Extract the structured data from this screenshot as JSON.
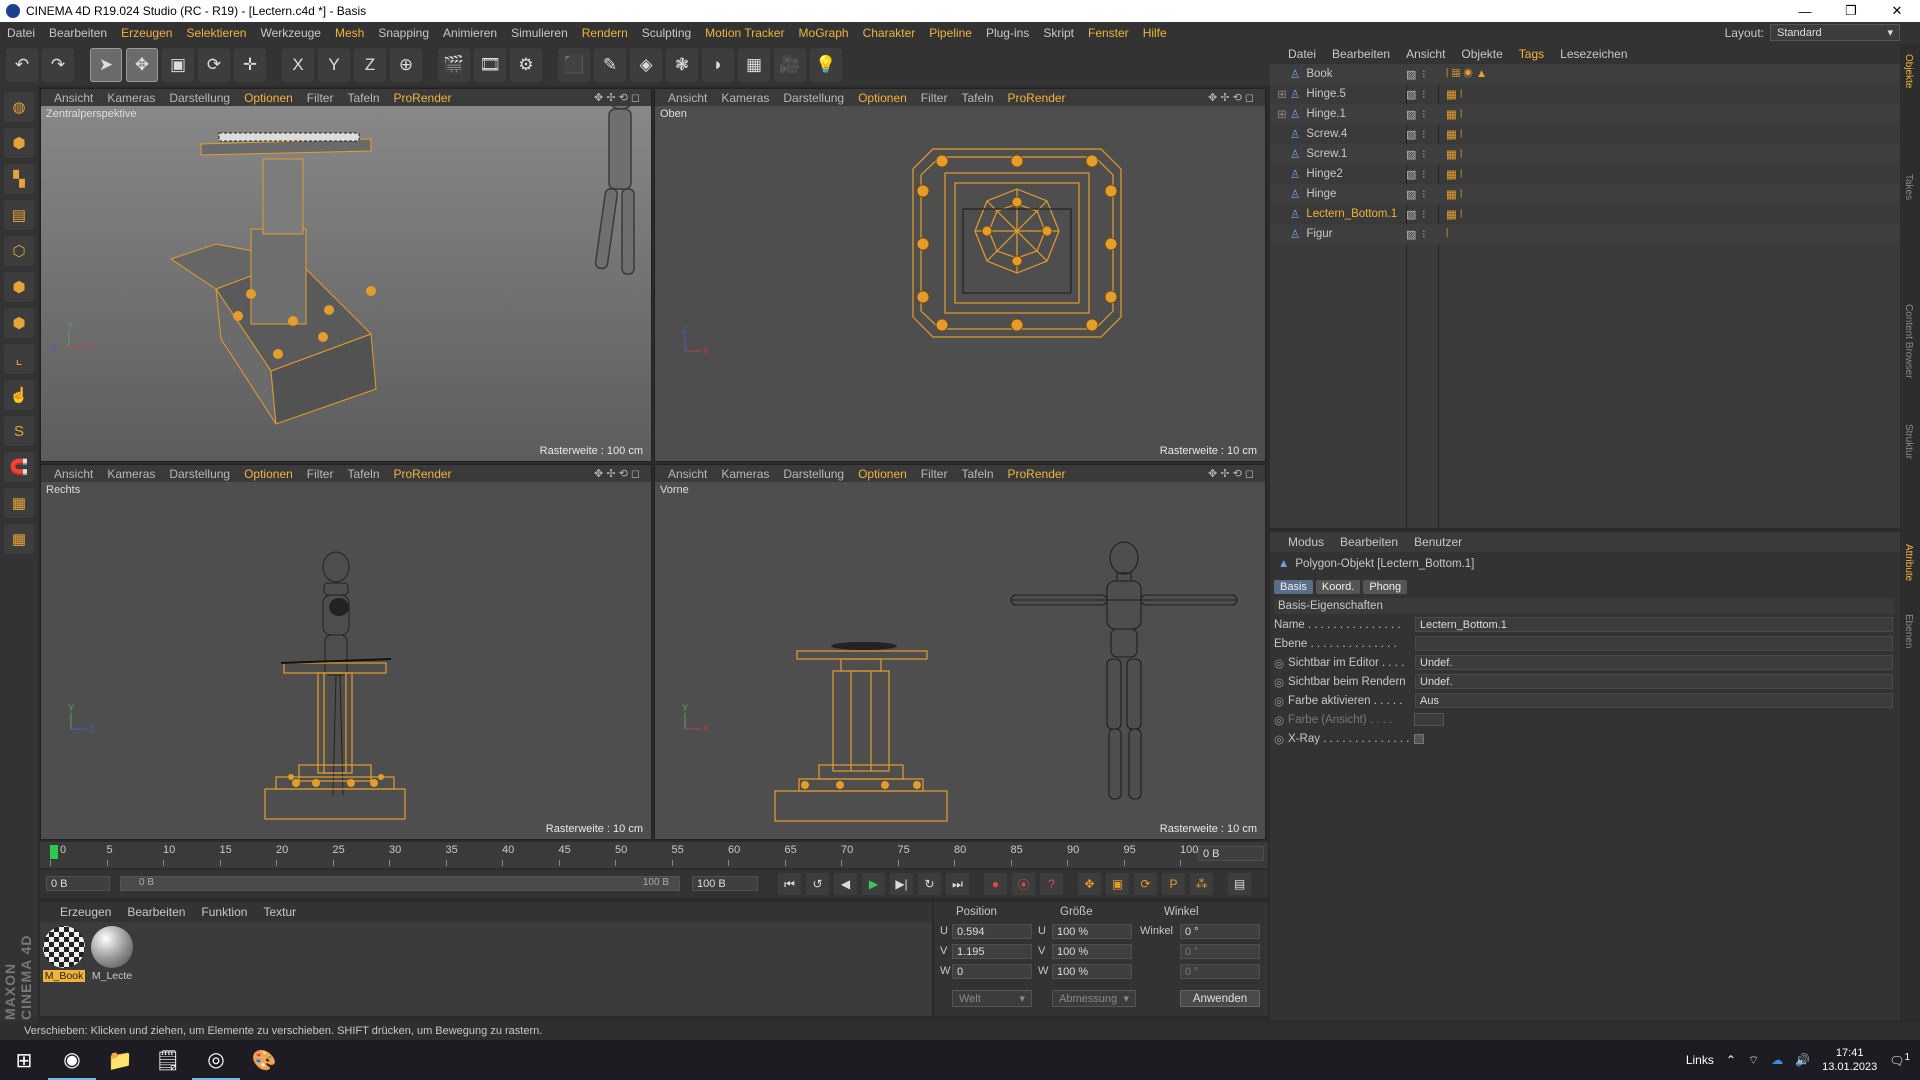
{
  "window": {
    "title": "CINEMA 4D R19.024 Studio (RC - R19) - [Lectern.c4d *] - Basis",
    "minimize": "—",
    "maximize": "❐",
    "close": "✕"
  },
  "menubar": {
    "items": [
      {
        "label": "Datei",
        "hi": false
      },
      {
        "label": "Bearbeiten",
        "hi": false
      },
      {
        "label": "Erzeugen",
        "hi": true
      },
      {
        "label": "Selektieren",
        "hi": true
      },
      {
        "label": "Werkzeuge",
        "hi": false
      },
      {
        "label": "Mesh",
        "hi": true
      },
      {
        "label": "Snapping",
        "hi": false
      },
      {
        "label": "Animieren",
        "hi": false
      },
      {
        "label": "Simulieren",
        "hi": false
      },
      {
        "label": "Rendern",
        "hi": true
      },
      {
        "label": "Sculpting",
        "hi": false
      },
      {
        "label": "Motion Tracker",
        "hi": true
      },
      {
        "label": "MoGraph",
        "hi": true
      },
      {
        "label": "Charakter",
        "hi": true
      },
      {
        "label": "Pipeline",
        "hi": true
      },
      {
        "label": "Plug-ins",
        "hi": false
      },
      {
        "label": "Skript",
        "hi": false
      },
      {
        "label": "Fenster",
        "hi": true
      },
      {
        "label": "Hilfe",
        "hi": true
      }
    ],
    "layout_label": "Layout:",
    "layout_value": "Standard"
  },
  "toolbar": {
    "icons": [
      "undo-icon",
      "redo-icon",
      "select-arrow-icon",
      "move-icon",
      "scale-icon",
      "rotate-icon",
      "last-tool-icon",
      "x-axis-icon",
      "y-axis-icon",
      "z-axis-icon",
      "world-coord-icon",
      "render-view-icon",
      "render-picture-viewer-icon",
      "render-settings-icon",
      "cube-icon",
      "pen-icon",
      "subdivision-icon",
      "cloner-icon",
      "deformer-icon",
      "floor-icon",
      "camera-icon",
      "light-icon"
    ],
    "glyphs": [
      "↶",
      "↷",
      "➤",
      "✥",
      "▣",
      "⟳",
      "✛",
      "X",
      "Y",
      "Z",
      "⊕",
      "🎬",
      "🎞",
      "⚙",
      "⬛",
      "✎",
      "◈",
      "❃",
      "◗",
      "▦",
      "🎥",
      "💡"
    ]
  },
  "lefttools": {
    "icons": [
      "make-editable-icon",
      "model-mode-icon",
      "texture-mode-icon",
      "workplane-icon",
      "points-mode-icon",
      "edges-mode-icon",
      "polygons-mode-icon",
      "axis-mode-icon",
      "tweak-mode-icon",
      "solo-icon",
      "magnet-icon",
      "snap-grid-icon",
      "snap-settings-icon"
    ],
    "glyphs": [
      "◍",
      "⬢",
      "▚",
      "▤",
      "⬡",
      "⬢",
      "⬢",
      "⌞",
      "☝",
      "S",
      "🧲",
      "▦",
      "▦"
    ]
  },
  "viewport_menu": {
    "ansicht": "Ansicht",
    "kameras": "Kameras",
    "darstellung": "Darstellung",
    "optionen": "Optionen",
    "filter": "Filter",
    "tafeln": "Tafeln",
    "prorender": "ProRender"
  },
  "viewport_icons": "✥ ✢ ⟲ ◻",
  "viewports": [
    {
      "name": "Zentralperspektive",
      "grid": "Rasterweite : 100 cm"
    },
    {
      "name": "Oben",
      "grid": "Rasterweite : 10 cm"
    },
    {
      "name": "Rechts",
      "grid": "Rasterweite : 10 cm"
    },
    {
      "name": "Vorne",
      "grid": "Rasterweite : 10 cm"
    }
  ],
  "object_manager": {
    "menu": [
      "Datei",
      "Bearbeiten",
      "Ansicht",
      "Objekte",
      "Tags",
      "Lesezeichen"
    ],
    "objects": [
      {
        "name": "Book",
        "hi": false
      },
      {
        "name": "Hinge.5",
        "hi": false
      },
      {
        "name": "Hinge.1",
        "hi": false
      },
      {
        "name": "Screw.4",
        "hi": false
      },
      {
        "name": "Screw.1",
        "hi": false
      },
      {
        "name": "Hinge2",
        "hi": false
      },
      {
        "name": "Hinge",
        "hi": false
      },
      {
        "name": "Lectern_Bottom.1",
        "hi": true
      },
      {
        "name": "Figur",
        "hi": false
      }
    ]
  },
  "attributes": {
    "menu": [
      "Modus",
      "Bearbeiten",
      "Benutzer"
    ],
    "object_title": "Polygon-Objekt [Lectern_Bottom.1]",
    "tabs": [
      "Basis",
      "Koord.",
      "Phong"
    ],
    "section": "Basis-Eigenschaften",
    "rows": [
      {
        "label": "Name . . . . . . . . . . . . . . .",
        "value": "Lectern_Bottom.1"
      },
      {
        "label": "Ebene . . . . . . . . . . . . . .",
        "value": ""
      },
      {
        "label": "Sichtbar im Editor . . . .",
        "value": "Undef."
      },
      {
        "label": "Sichtbar beim Rendern",
        "value": "Undef."
      },
      {
        "label": "Farbe aktivieren . . . . .",
        "value": "Aus"
      },
      {
        "label": "Farbe (Ansicht) . . . .",
        "value": ""
      },
      {
        "label": "X-Ray . . . . . . . . . . . . . .",
        "value": ""
      }
    ]
  },
  "right_tabs": [
    "Objekte",
    "Takes",
    "Content Browser",
    "Struktur",
    "Attribute",
    "Ebenen"
  ],
  "timeline": {
    "ticks": [
      "0",
      "5",
      "10",
      "15",
      "20",
      "25",
      "30",
      "35",
      "40",
      "45",
      "50",
      "55",
      "60",
      "65",
      "70",
      "75",
      "80",
      "85",
      "90",
      "95",
      "100"
    ],
    "frame_display": "0 B",
    "start": "0 B",
    "range_start": "0 B",
    "range_end": "100 B",
    "end": "100 B"
  },
  "playback": {
    "icons": [
      "go-start-icon",
      "prev-key-icon",
      "prev-frame-icon",
      "play-icon",
      "next-frame-icon",
      "next-key-icon",
      "go-end-icon",
      "record-icon",
      "autokey-icon",
      "keyframe-selection-icon",
      "move-key-icon",
      "scale-key-icon",
      "rotate-key-icon",
      "param-key-icon",
      "pla-key-icon",
      "timeline-icon"
    ],
    "glyphs": [
      "⏮",
      "↺",
      "◀",
      "▶",
      "▶|",
      "↻",
      "⏭",
      "●",
      "⦿",
      "?",
      "✥",
      "▣",
      "⟳",
      "P",
      "⁂",
      "▤"
    ]
  },
  "materials": {
    "menu": [
      "Erzeugen",
      "Bearbeiten",
      "Funktion",
      "Textur"
    ],
    "items": [
      "M_Book",
      "M_Lecte"
    ]
  },
  "coordinates": {
    "headers": {
      "position": "Position",
      "groesse": "Größe",
      "winkel": "Winkel"
    },
    "rows": [
      {
        "axis": "U",
        "pos": "0.594",
        "size_axis": "U",
        "size": "100 %",
        "ang_label": "Winkel",
        "ang": "0 °"
      },
      {
        "axis": "V",
        "pos": "1.195",
        "size_axis": "V",
        "size": "100 %",
        "ang_label": "",
        "ang": "0 °"
      },
      {
        "axis": "W",
        "pos": "0",
        "size_axis": "W",
        "size": "100 %",
        "ang_label": "",
        "ang": "0 °"
      }
    ],
    "space": "Welt",
    "scale_mode": "Abmessung",
    "apply": "Anwenden"
  },
  "maxon_logo": "MAXON CINEMA 4D",
  "statusbar": "Verschieben: Klicken und ziehen, um Elemente zu verschieben. SHIFT drücken, um Bewegung zu rastern.",
  "taskbar": {
    "apps": [
      "windows-start-icon",
      "chrome-icon",
      "file-explorer-icon",
      "notepad-icon",
      "cinema4d-icon",
      "paint-icon"
    ],
    "glyphs": [
      "⊞",
      "◉",
      "📁",
      "🗒",
      "◎",
      "🎨"
    ],
    "links": "Links",
    "time": "17:41",
    "date": "13.01.2023",
    "notif": "1"
  },
  "colors": {
    "accent": "#f0b43c",
    "wire": "#e39d2a",
    "viewport": "#4e4e4e"
  }
}
